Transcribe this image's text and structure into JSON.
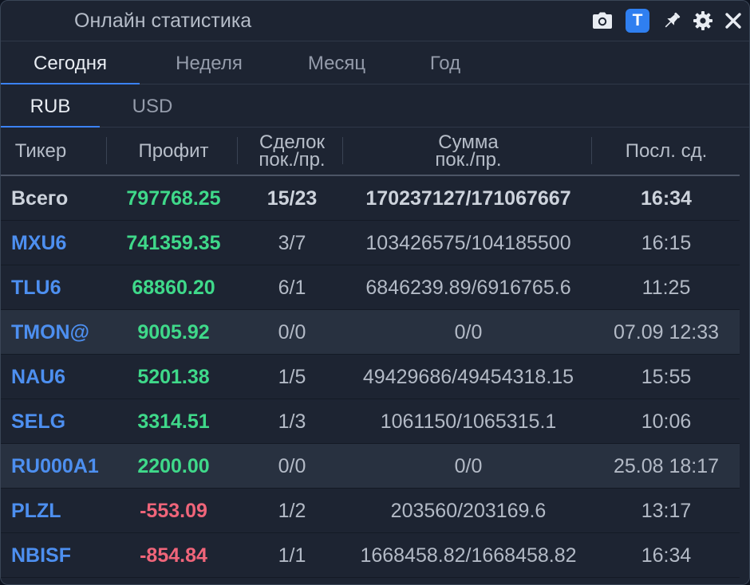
{
  "window": {
    "title": "Онлайн статистика"
  },
  "toolbar": {
    "camera": "camera-icon",
    "text_toggle_label": "T",
    "pin": "pin-icon",
    "settings": "gear-icon",
    "close": "close-icon"
  },
  "period_tabs": [
    {
      "label": "Сегодня",
      "active": true
    },
    {
      "label": "Неделя",
      "active": false
    },
    {
      "label": "Месяц",
      "active": false
    },
    {
      "label": "Год",
      "active": false
    }
  ],
  "currency_tabs": [
    {
      "label": "RUB",
      "active": true
    },
    {
      "label": "USD",
      "active": false
    }
  ],
  "table": {
    "headers": {
      "ticker": "Тикер",
      "profit": "Профит",
      "deals_line1": "Сделок",
      "deals_line2": "пок./пр.",
      "sum_line1": "Сумма",
      "sum_line2": "пок./пр.",
      "last": "Посл. сд."
    },
    "total": {
      "ticker": "Всего",
      "profit": "797768.25",
      "deals": "15/23",
      "sum": "170237127/171067667",
      "last": "16:34"
    },
    "rows": [
      {
        "ticker": "MXU6",
        "profit": "741359.35",
        "deals": "3/7",
        "sum": "103426575/104185500",
        "last": "16:15",
        "sign": "pos",
        "alt": false
      },
      {
        "ticker": "TLU6",
        "profit": "68860.20",
        "deals": "6/1",
        "sum": "6846239.89/6916765.6",
        "last": "11:25",
        "sign": "pos",
        "alt": false
      },
      {
        "ticker": "TMON@",
        "profit": "9005.92",
        "deals": "0/0",
        "sum": "0/0",
        "last": "07.09 12:33",
        "sign": "pos",
        "alt": true
      },
      {
        "ticker": "NAU6",
        "profit": "5201.38",
        "deals": "1/5",
        "sum": "49429686/49454318.15",
        "last": "15:55",
        "sign": "pos",
        "alt": false
      },
      {
        "ticker": "SELG",
        "profit": "3314.51",
        "deals": "1/3",
        "sum": "1061150/1065315.1",
        "last": "10:06",
        "sign": "pos",
        "alt": false
      },
      {
        "ticker": "RU000A1",
        "profit": "2200.00",
        "deals": "0/0",
        "sum": "0/0",
        "last": "25.08 18:17",
        "sign": "pos",
        "alt": true
      },
      {
        "ticker": "PLZL",
        "profit": "-553.09",
        "deals": "1/2",
        "sum": "203560/203169.6",
        "last": "13:17",
        "sign": "neg",
        "alt": false
      },
      {
        "ticker": "NBISF",
        "profit": "-854.84",
        "deals": "1/1",
        "sum": "1668458.82/1668458.82",
        "last": "16:34",
        "sign": "neg",
        "alt": false
      }
    ]
  },
  "colors": {
    "positive": "#3fd98a",
    "negative": "#f0657a",
    "ticker": "#4d8ff0",
    "accent": "#2f7ff0"
  }
}
